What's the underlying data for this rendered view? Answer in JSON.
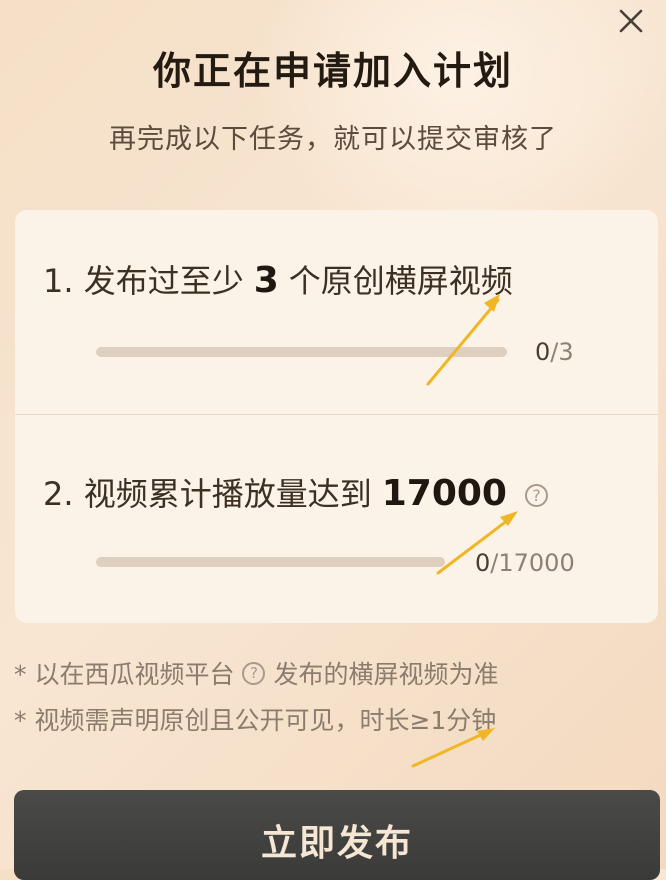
{
  "dialog": {
    "title": "你正在申请加入计划",
    "subtitle": "再完成以下任务，就可以提交审核了",
    "close_icon": "close-icon"
  },
  "tasks": [
    {
      "prefix": "1. 发布过至少",
      "number": "3",
      "suffix": "个原创横屏视频",
      "progress_current": "0",
      "progress_total": "/3",
      "progress_fraction": 0
    },
    {
      "prefix": "2. 视频累计播放量达到",
      "number": "17000",
      "suffix": "",
      "help": "?",
      "progress_current": "0",
      "progress_total": "/17000",
      "progress_fraction": 0
    }
  ],
  "notes": {
    "note1_before": "* 以在西瓜视频平台",
    "note1_help": "?",
    "note1_after": "发布的横屏视频为准",
    "note2": "* 视频需声明原创且公开可见，时长≥1分钟"
  },
  "actions": {
    "publish_label": "立即发布"
  },
  "colors": {
    "background": "#f5dfc6",
    "card": "#fcf3e8",
    "button": "#3f3f3e",
    "button_text": "#f6e7d4",
    "arrow": "#f0b624"
  }
}
